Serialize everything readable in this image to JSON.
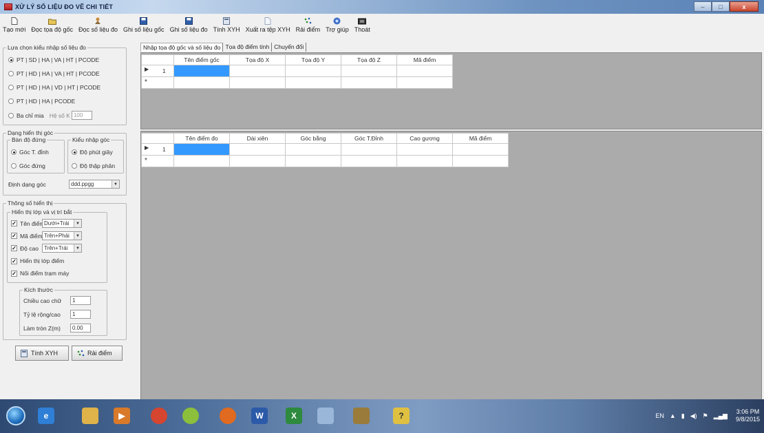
{
  "window": {
    "title": "XỬ LÝ SỐ LIỆU ĐO VẼ CHI TIẾT",
    "controls": {
      "minimize": "–",
      "maximize": "□",
      "close": "x"
    }
  },
  "toolbar": [
    {
      "label": "Tạo mới",
      "icon": "new-file-icon"
    },
    {
      "label": "Đọc tọa độ gốc",
      "icon": "open-folder-icon"
    },
    {
      "label": "Đọc số liệu đo",
      "icon": "read-survey-icon"
    },
    {
      "label": "Ghi số liệu gốc",
      "icon": "save-disk-icon"
    },
    {
      "label": "Ghi số liệu đo",
      "icon": "save-disk-icon"
    },
    {
      "label": "Tính XYH",
      "icon": "calculator-icon"
    },
    {
      "label": "Xuất ra tệp XYH",
      "icon": "export-file-icon"
    },
    {
      "label": "Rải điểm",
      "icon": "scatter-points-icon"
    },
    {
      "label": "Trợ giúp",
      "icon": "help-icon"
    },
    {
      "label": "Thoát",
      "icon": "exit-icon"
    }
  ],
  "input_type": {
    "legend": "Lựa chọn kiểu nhập số liệu đo",
    "options": [
      {
        "label": "PT | SD | HA | VA | HT | PCODE",
        "selected": true
      },
      {
        "label": "PT | HD | HA | VA | HT | PCODE",
        "selected": false
      },
      {
        "label": "PT | HD | HA | VD | HT | PCODE",
        "selected": false
      },
      {
        "label": "PT | HD | HA | PCODE",
        "selected": false
      },
      {
        "label": "Ba chỉ mia",
        "selected": false
      }
    ],
    "k_label": "Hệ số K",
    "k_value": "100"
  },
  "angle_display": {
    "legend": "Dạng hiển thị góc",
    "vertical_legend": "Bàn độ đứng",
    "vertical_options": [
      {
        "label": "Góc T. đỉnh",
        "selected": true
      },
      {
        "label": "Góc đứng",
        "selected": false
      }
    ],
    "input_legend": "Kiểu nhập góc",
    "input_options": [
      {
        "label": "Độ phút giây",
        "selected": true
      },
      {
        "label": "Độ thập phân",
        "selected": false
      }
    ],
    "format_label": "Định dạng góc",
    "format_value": "ddd.ppgg"
  },
  "display_params": {
    "legend": "Thông số hiển thị",
    "layer_legend": "Hiển thị lớp và vị trí bắt",
    "layers": [
      {
        "label": "Tên điểm",
        "checked": true,
        "position": "Dưới+Trái"
      },
      {
        "label": "Mã điểm",
        "checked": true,
        "position": "Trên+Phải"
      },
      {
        "label": "Độ cao",
        "checked": true,
        "position": "Trên+Trái"
      }
    ],
    "show_point_layer": {
      "label": "Hiển thị lớp điểm",
      "checked": true
    },
    "connect_station": {
      "label": "Nối điểm trạm máy",
      "checked": true
    },
    "size_legend": "Kích thước",
    "text_height_label": "Chiều cao chữ",
    "text_height": "1",
    "ratio_label": "Tỷ lệ rộng/cao",
    "ratio": "1",
    "round_label": "Làm tròn Z(m)",
    "round": "0.00"
  },
  "bottom_buttons": {
    "calc": "Tính XYH",
    "scatter": "Rải điểm"
  },
  "tabs": [
    {
      "label": "Nhập tọa độ gốc và số liệu đo",
      "active": true
    },
    {
      "label": "Tọa độ điểm tính",
      "active": false
    },
    {
      "label": "Chuyển đổi",
      "active": false
    }
  ],
  "grid_origin": {
    "columns": [
      "Tên điểm gốc",
      "Tọa độ X",
      "Tọa độ Y",
      "Tọa độ Z",
      "Mã điểm"
    ],
    "row_number": "1"
  },
  "grid_survey": {
    "columns": [
      "Tên điểm đo",
      "Dài xiên",
      "Góc bằng",
      "Góc T.Đỉnh",
      "Cao gương",
      "Mã điểm"
    ],
    "row_number": "1"
  },
  "taskbar": {
    "lang": "EN",
    "time": "3:06 PM",
    "date": "9/8/2015",
    "apps": [
      {
        "icon": "start-orb-icon",
        "glyph": "",
        "color": "#1f6fbf"
      },
      {
        "icon": "internet-explorer-icon",
        "glyph": "e",
        "color": "#2f7fd6"
      },
      {
        "icon": "file-explorer-icon",
        "glyph": "",
        "color": "#e0b24a"
      },
      {
        "icon": "media-player-icon",
        "glyph": "▶",
        "color": "#d9792a"
      },
      {
        "icon": "chrome-icon",
        "glyph": "",
        "color": "#d6452f"
      },
      {
        "icon": "paint-app-icon",
        "glyph": "",
        "color": "#8bbf3c"
      },
      {
        "icon": "firefox-icon",
        "glyph": "",
        "color": "#e06a1f"
      },
      {
        "icon": "word-icon",
        "glyph": "W",
        "color": "#2c5aa8"
      },
      {
        "icon": "excel-icon",
        "glyph": "X",
        "color": "#2d8a3e"
      },
      {
        "icon": "paint-brush-icon",
        "glyph": "",
        "color": "#9ab6d8"
      },
      {
        "icon": "app-lamp-icon",
        "glyph": "",
        "color": "#9a7b3a"
      },
      {
        "icon": "help-tool-icon",
        "glyph": "?",
        "color": "#e0c040"
      }
    ]
  }
}
